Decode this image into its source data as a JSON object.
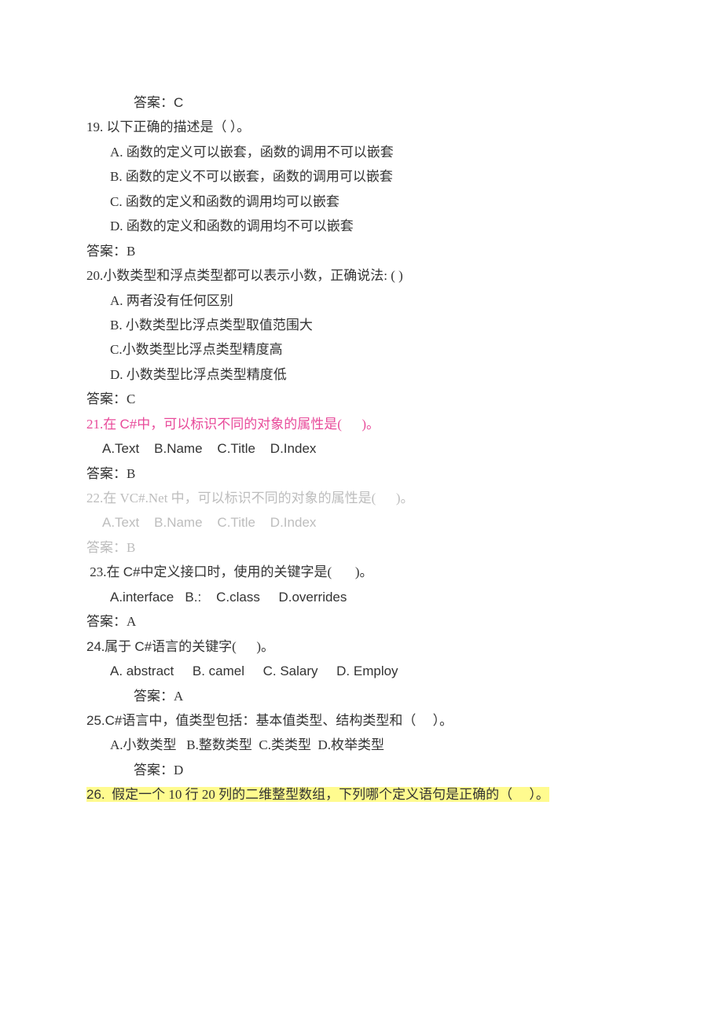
{
  "ans18": "答案：C",
  "q19": {
    "stem": "19.  以下正确的描述是（     ）。",
    "a": "A.  函数的定义可以嵌套，函数的调用不可以嵌套",
    "b": "B.  函数的定义不可以嵌套，函数的调用可以嵌套",
    "c": "C.  函数的定义和函数的调用均可以嵌套",
    "d": "D.  函数的定义和函数的调用均不可以嵌套",
    "ans": "答案：B"
  },
  "q20": {
    "stem": "20.小数类型和浮点类型都可以表示小数，正确说法:  (      )",
    "a": "A.  两者没有任何区别",
    "b": "B.  小数类型比浮点类型取值范围大",
    "c": "C.小数类型比浮点类型精度高",
    "d": "D.  小数类型比浮点类型精度低",
    "ans": "答案：C"
  },
  "q21": {
    "pre": "21.在 ",
    "csharp": "C#",
    "post": "中，可以标识不同的对象的属性是(      )。",
    "opts": "A.Text    B.Name    C.Title    D.Index",
    "ans": "答案：B"
  },
  "q22": {
    "stem": "22.在 VC#.Net 中，可以标识不同的对象的属性是(      )。",
    "opts": "A.Text    B.Name    C.Title    D.Index",
    "ans": "答案：B"
  },
  "q23": {
    "pre": " 23.在 ",
    "csharp": "C#",
    "post": "中定义接口时，使用的关键字是(       )。",
    "opts": "A.interface   B.:    C.class     D.overrides",
    "ans": "答案：A"
  },
  "q24": {
    "num": "24",
    "mid1": ".属于 ",
    "csharp": "C#",
    "post": "语言的关键字(      )。",
    "opts": "A. abstract     B. camel     C. Salary     D. Employ",
    "ans": "答案：A"
  },
  "q25": {
    "num": "25.C#",
    "post": "语言中，值类型包括：基本值类型、结构类型和（     ）。",
    "opts": "A.小数类型   B.整数类型  C.类类型  D.枚举类型",
    "ans": "答案：D"
  },
  "q26": {
    "num": "26.",
    "stem": "  假定一个 10 行 20 列的二维整型数组，下列哪个定义语句是正确的（     ）。"
  }
}
